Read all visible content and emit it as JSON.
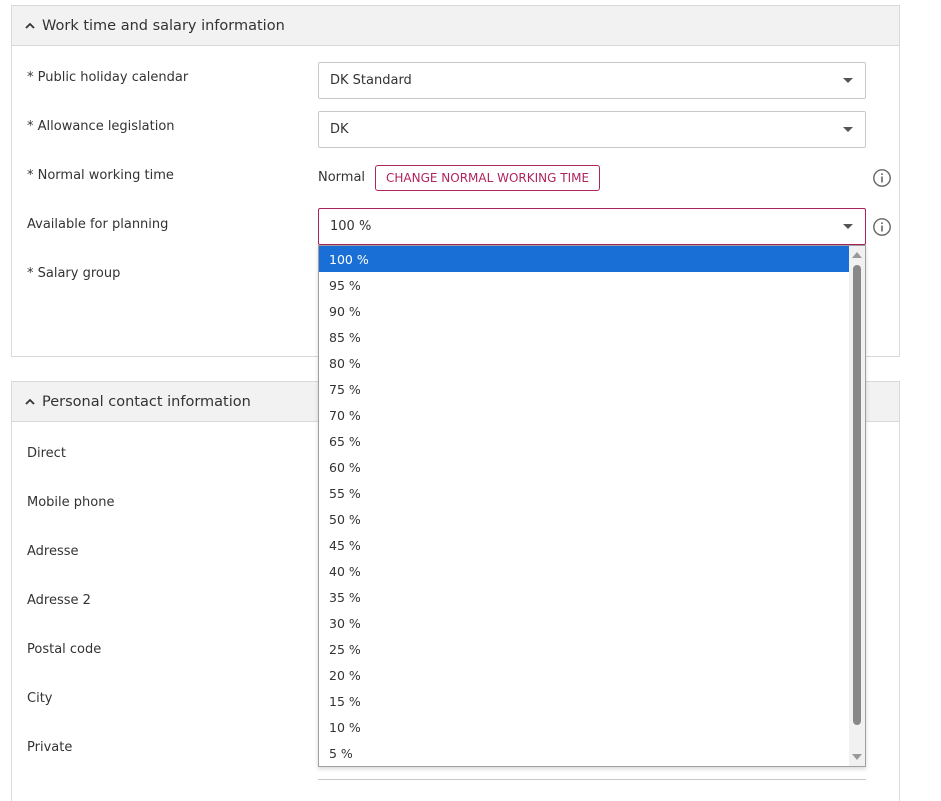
{
  "work_section": {
    "title": "Work time and salary information",
    "fields": {
      "holiday_label": "* Public holiday calendar",
      "holiday_value": "DK Standard",
      "allowance_label": "* Allowance legislation",
      "allowance_value": "DK",
      "normal_label": "* Normal working time",
      "normal_value": "Normal",
      "change_button": "CHANGE NORMAL WORKING TIME",
      "planning_label": "Available for planning",
      "planning_value": "100 %",
      "salary_label": "* Salary group"
    }
  },
  "contact_section": {
    "title": "Personal contact information",
    "labels": [
      "Direct",
      "Mobile phone",
      "Adresse",
      "Adresse 2",
      "Postal code",
      "City",
      "Private"
    ]
  },
  "dropdown": {
    "selected": "100 %",
    "options": [
      "100 %",
      "95 %",
      "90 %",
      "85 %",
      "80 %",
      "75 %",
      "70 %",
      "65 %",
      "60 %",
      "55 %",
      "50 %",
      "45 %",
      "40 %",
      "35 %",
      "30 %",
      "25 %",
      "20 %",
      "15 %",
      "10 %",
      "5 %"
    ]
  },
  "colors": {
    "accent": "#b0245e",
    "selection": "#1a6fd6",
    "header_bg": "#f2f2f2"
  }
}
